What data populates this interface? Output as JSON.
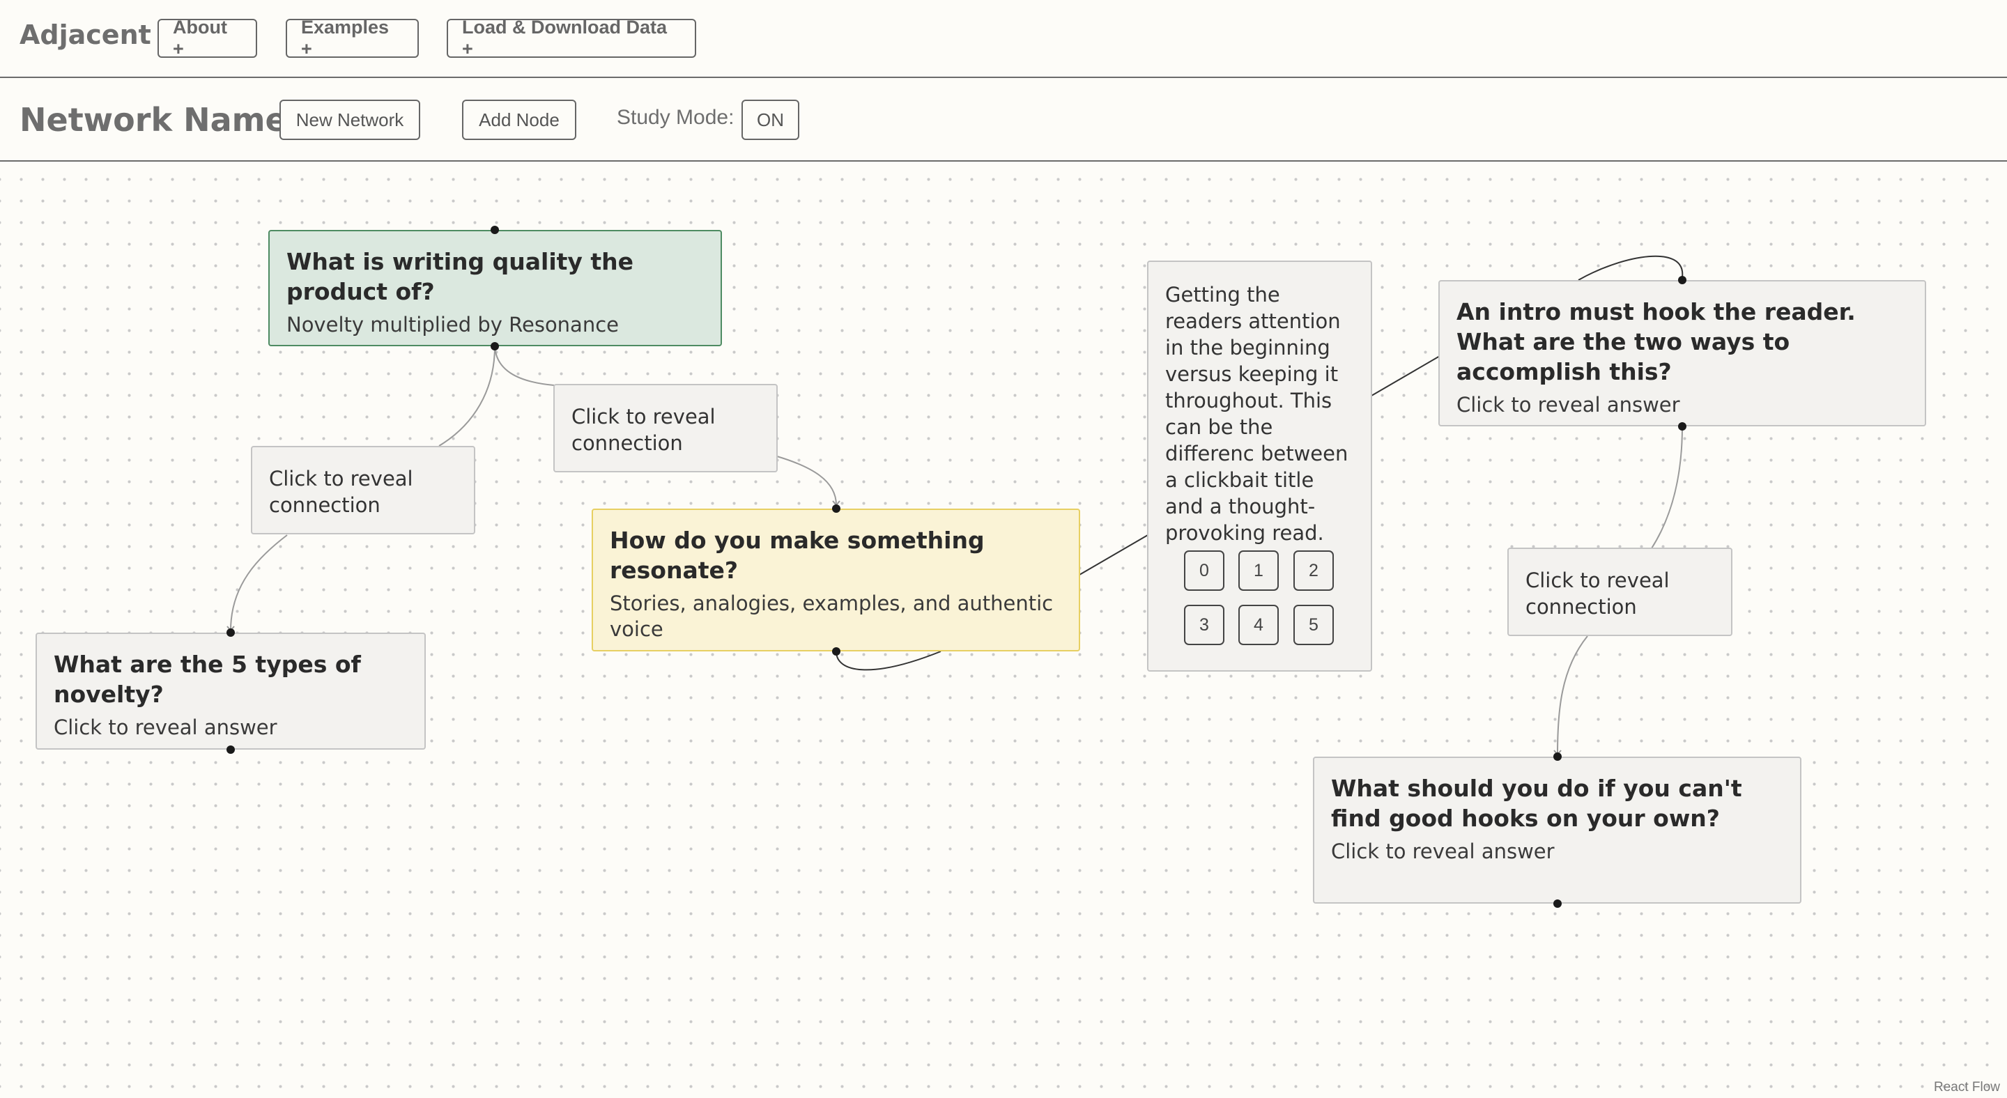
{
  "app": {
    "title": "Adjacent"
  },
  "topbar": {
    "about": "About +",
    "examples": "Examples +",
    "load": "Load & Download Data +"
  },
  "toolbar": {
    "network_name": "Network Name",
    "new_network": "New Network",
    "add_node": "Add Node",
    "study_mode_label": "Study Mode:",
    "study_mode_value": "ON"
  },
  "nodes": {
    "writing_quality": {
      "question": "What is writing quality the product of?",
      "answer": "Novelty multiplied by Resonance"
    },
    "novelty": {
      "question": "What are the 5 types of novelty?",
      "answer": "Click to reveal answer"
    },
    "resonate": {
      "question": "How do you make something resonate?",
      "answer": "Stories, analogies, examples, and authentic voice"
    },
    "intro_hook": {
      "question": "An intro must hook the reader. What are the two ways to accomplish this?",
      "answer": "Click to reveal answer"
    },
    "good_hooks": {
      "question": "What should you do if you can't find good hooks on your own?",
      "answer": "Click to reveal answer"
    }
  },
  "connections": {
    "c1": "Click to reveal connection",
    "c2": "Click to reveal connection",
    "c3": "Click to reveal connection"
  },
  "revealed_connection": {
    "text": "Getting the readers attention in the beginning versus keeping it throughout. This can be the differenc between a clickbait title and a thought-provoking read.",
    "ratings": [
      "0",
      "1",
      "2",
      "3",
      "4",
      "5"
    ]
  },
  "watermark": "React Flow"
}
